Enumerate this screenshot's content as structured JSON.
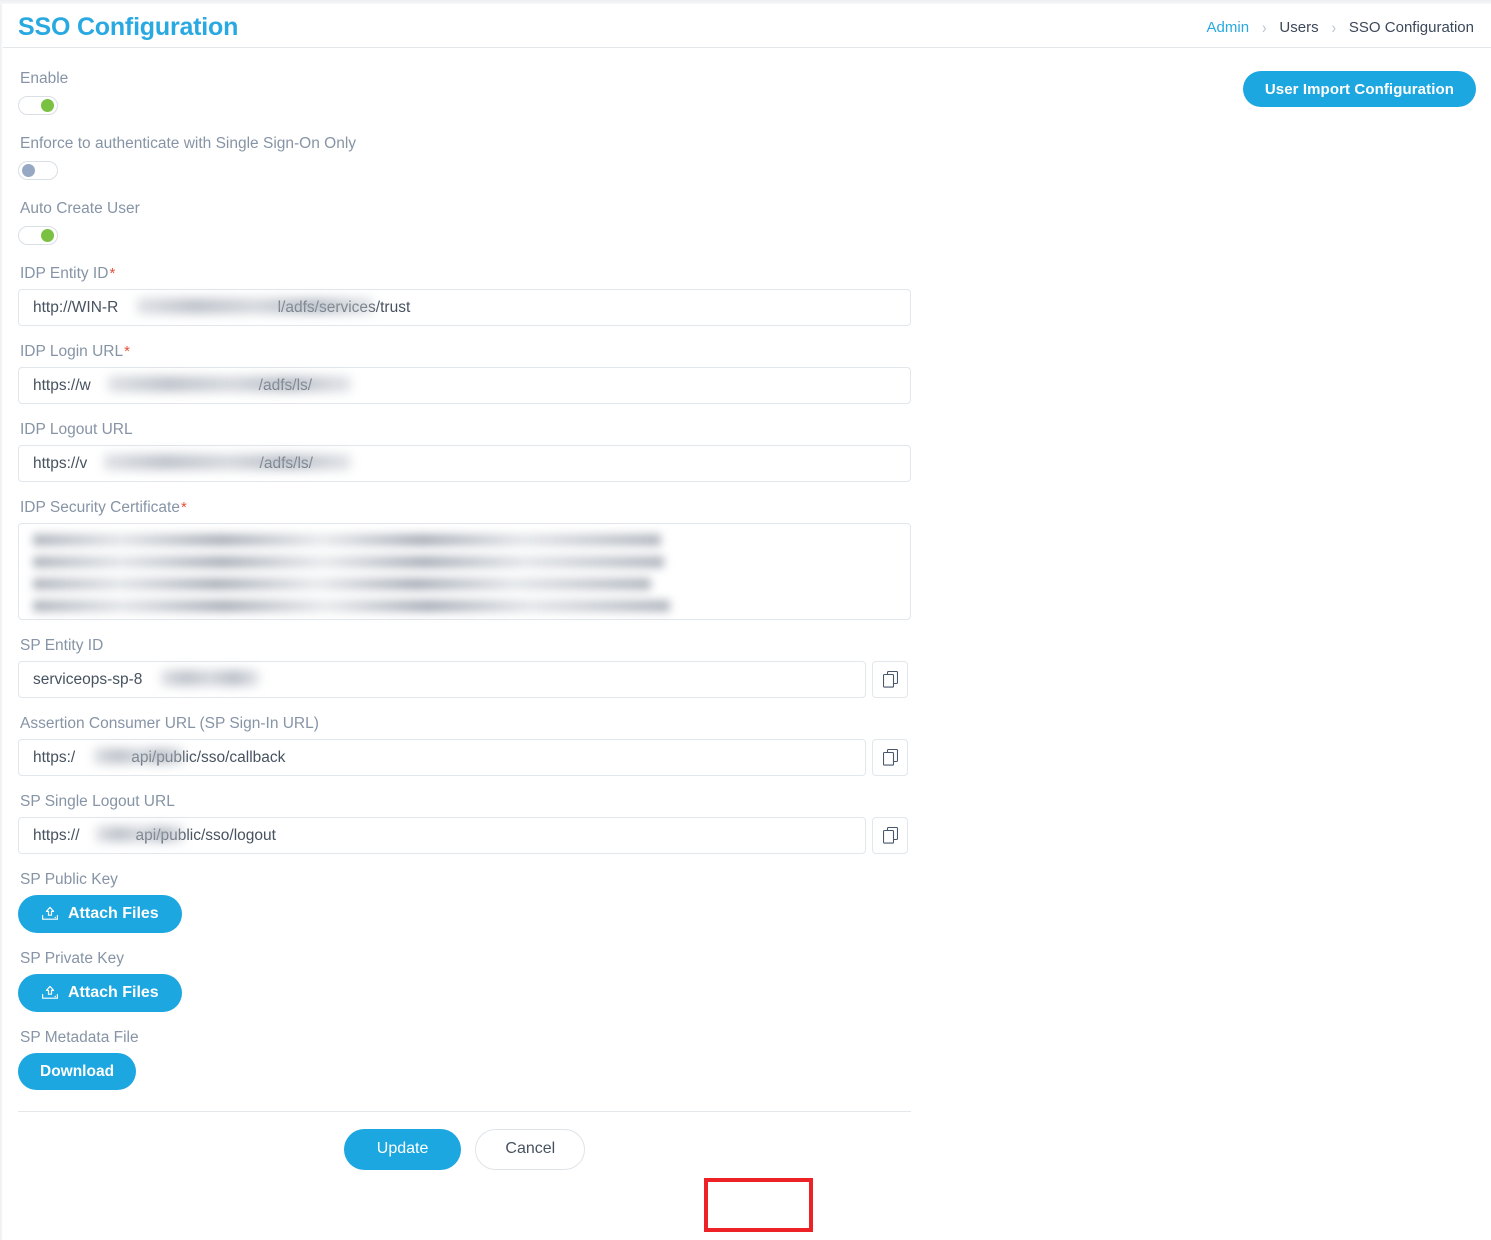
{
  "window": {
    "title": "SSO Configuration"
  },
  "header": {
    "title": "SSO Configuration",
    "breadcrumb": [
      {
        "label": "Admin",
        "link": true
      },
      {
        "label": "Users",
        "link": false
      },
      {
        "label": "SSO Configuration",
        "link": false
      }
    ],
    "separator": "›"
  },
  "toolbar": {
    "user_import_label": "User Import Configuration",
    "accent_color": "#1da7e0"
  },
  "form": {
    "enable": {
      "label": "Enable",
      "state": "on",
      "knob_color": "#7ac142"
    },
    "enforce_sso": {
      "label": "Enforce to authenticate with Single Sign-On Only",
      "state": "off",
      "knob_color": "#97a8c4"
    },
    "auto_create_user": {
      "label": "Auto Create User",
      "state": "on",
      "knob_color": "#7ac142"
    },
    "idp_entity_id": {
      "label": "IDP Entity ID",
      "required": true,
      "required_marker": "*",
      "value_prefix": "http://WIN-R",
      "value_suffix": "l/adfs/services/trust",
      "redacted": true
    },
    "idp_login_url": {
      "label": "IDP Login URL",
      "required": true,
      "required_marker": "*",
      "value_prefix": "https://w",
      "value_suffix": "/adfs/ls/",
      "redacted": true
    },
    "idp_logout_url": {
      "label": "IDP Logout URL",
      "required": false,
      "value_prefix": "https://v",
      "value_suffix": "/adfs/ls/",
      "redacted": true
    },
    "idp_security_certificate": {
      "label": "IDP Security Certificate",
      "required": true,
      "required_marker": "*",
      "value": "",
      "redacted": true,
      "redacted_lines": 4
    },
    "sp_entity_id": {
      "label": "SP Entity ID",
      "required": false,
      "value_prefix": "serviceops-sp-8",
      "value_suffix": "",
      "redacted": true,
      "copy_icon": "copy-icon"
    },
    "assertion_consumer_url": {
      "label": "Assertion Consumer URL (SP Sign-In URL)",
      "required": false,
      "value_prefix": "https:/",
      "value_suffix": "api/public/sso/callback",
      "redacted": true,
      "copy_icon": "copy-icon"
    },
    "sp_single_logout_url": {
      "label": "SP Single Logout URL",
      "required": false,
      "value_prefix": "https://",
      "value_suffix": "api/public/sso/logout",
      "redacted": true,
      "copy_icon": "copy-icon"
    },
    "sp_public_key": {
      "label": "SP Public Key",
      "button_label": "Attach Files",
      "button_icon": "upload-icon"
    },
    "sp_private_key": {
      "label": "SP Private Key",
      "button_label": "Attach Files",
      "button_icon": "upload-icon"
    },
    "sp_metadata_file": {
      "label": "SP Metadata File",
      "button_label": "Download"
    }
  },
  "footer": {
    "update_label": "Update",
    "cancel_label": "Cancel",
    "highlight_color": "#ec2227"
  }
}
